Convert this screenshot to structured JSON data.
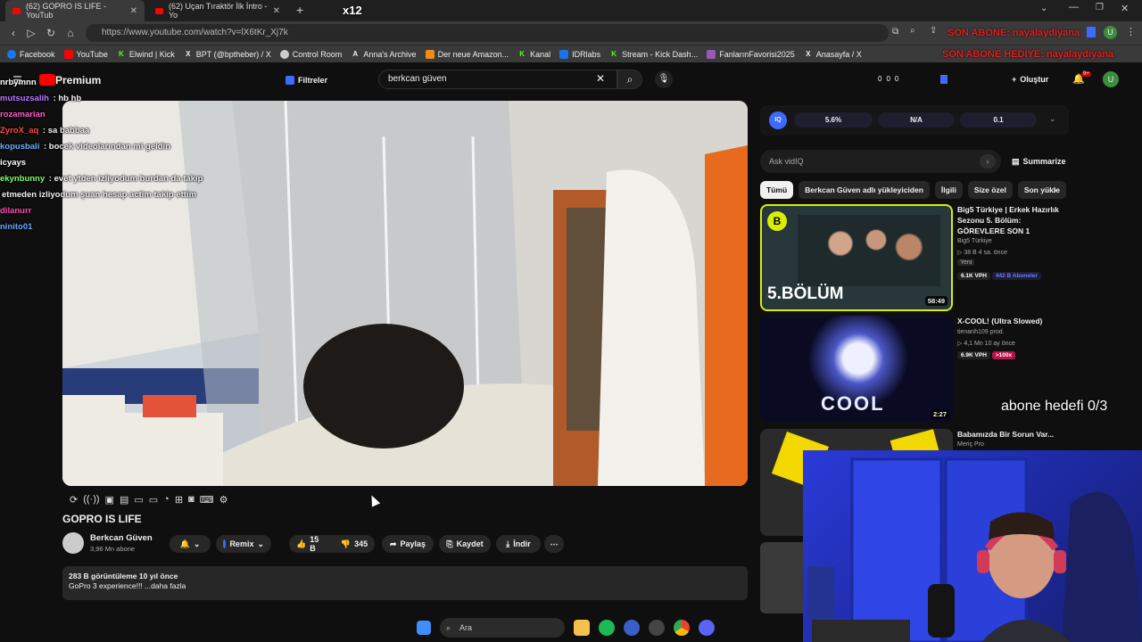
{
  "tabs": [
    {
      "label": "(62) GOPRO IS LIFE - YouTub"
    },
    {
      "label": "(62) Uçan Tıraktör İlk İntro - Yo"
    }
  ],
  "overlay": {
    "x12": "x12",
    "son_abone1": "SON ABONE: nayalaydiyana",
    "son_abone2": "SON ABONE HEDİYE: nayalaydiyana",
    "goal": "abone hedefi 0/3"
  },
  "url": "https://www.youtube.com/watch?v=lX6tKr_Xj7k",
  "bookmarks": [
    "Facebook",
    "YouTube",
    "Elwind | Kick",
    "BPT (@bptheber) / X",
    "Control Room",
    "Anna's Archive",
    "Der neue Amazon...",
    "Kanal",
    "IDRlabs",
    "Stream - Kick Dash...",
    "FanlarınFavorisi2025",
    "Anasayfa / X"
  ],
  "yt": {
    "premium": "Premium",
    "filters": "Filtreler",
    "search_value": "berkcan güven",
    "create": "Oluştur",
    "notif": "9+",
    "avatar": "U",
    "counts": [
      "0",
      "0",
      "0"
    ]
  },
  "chat": [
    {
      "user": "nrbymnn",
      "msg": "",
      "color": "#ffffff"
    },
    {
      "user": "mutsuzsalih",
      "msg": "hb hb",
      "color": "#bb77ff"
    },
    {
      "user": "rozamarian",
      "msg": "",
      "color": "#ff5ccf"
    },
    {
      "user": "ZyroX_aq",
      "msg": "sa babbaa",
      "color": "#ff4c4c"
    },
    {
      "user": "kopusbali",
      "msg": "bocek videolarından mi geldin",
      "color": "#66b2ff"
    },
    {
      "user": "icyays",
      "msg": "",
      "color": "#ffffff"
    },
    {
      "user": "ekynbunny",
      "msg": "evet ytden izliyodum burdan da takıp",
      "color": "#7fff66"
    },
    {
      "user": "",
      "msg": "etmeden izliyodum şuan hesap actim takip ettim",
      "color": "#ffffff"
    },
    {
      "user": "dilanurr",
      "msg": "",
      "color": "#ff4cb7"
    },
    {
      "user": "ninito01",
      "msg": "",
      "color": "#6aa8ff"
    }
  ],
  "video": {
    "title": "GOPRO IS LIFE",
    "channel": "Berkcan Güven",
    "subs": "3,96 Mn abone",
    "remix": "Remix",
    "likes": "15 B",
    "dislikes": "345",
    "share": "Paylaş",
    "save": "Kaydet",
    "download": "İndir",
    "views": "283 B görüntüleme  10 yıl önce",
    "desc": "GoPro 3 experience!!! ...daha fazla"
  },
  "vidiq": {
    "stat1": "5.6%",
    "stat2": "N/A",
    "stat3": "0.1",
    "ask": "Ask vidIQ",
    "summarize": "Summarize"
  },
  "chips": [
    "Tümü",
    "Berkcan Güven adlı yükleyiciden",
    "İlgili",
    "Size özel",
    "Son yükle"
  ],
  "recs": [
    {
      "title": "Big5 Türkiye | Erkek Hazırlık Sezonu 5. Bölüm: GÖREVLERE SON 1",
      "channel": "Big5 Türkiye",
      "meta": "▷ 38 B  4 sa. önce",
      "new": "Yeni",
      "vph": "6.1K VPH",
      "subs": "442 B Aboneler",
      "dur": "58:49",
      "thumbtext": "5.BÖLÜM"
    },
    {
      "title": "X-COOL! (Ultra Slowed)",
      "channel": "tienanh109 prod.",
      "meta": "▷ 4,1 Mn  10 ay önce",
      "vph": "6.9K VPH",
      "x": ">100x",
      "dur": "2:27",
      "thumbtext": "COOL"
    },
    {
      "title": "Babamızda Bir Sorun Var...",
      "channel": "Meriç Pro"
    }
  ],
  "taskbar": {
    "search": "Ara"
  },
  "colors": {
    "accent": "#ff0000",
    "vidiq": "#3d6bff"
  }
}
